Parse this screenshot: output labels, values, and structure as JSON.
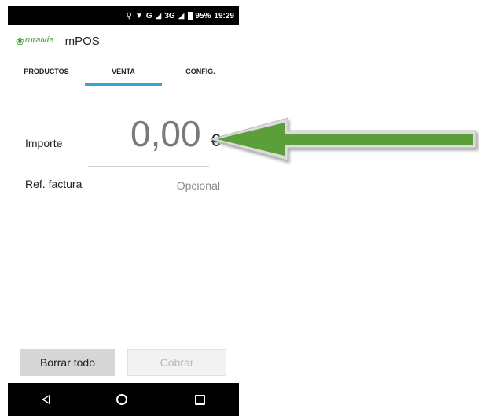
{
  "status_bar": {
    "network": "G",
    "network2": "3G",
    "battery": "95%",
    "time": "19:29"
  },
  "app_bar": {
    "logo_text": "ruralvía",
    "title": "mPOS"
  },
  "tabs": [
    {
      "label": "PRODUCTOS",
      "active": false
    },
    {
      "label": "VENTA",
      "active": true
    },
    {
      "label": "CONFIG.",
      "active": false
    }
  ],
  "form": {
    "amount_label": "Importe",
    "amount_value": "0,00",
    "currency": "€",
    "ref_label": "Ref. factura",
    "ref_placeholder": "Opcional"
  },
  "buttons": {
    "clear": "Borrar todo",
    "charge": "Cobrar"
  },
  "annotation": {
    "arrow_color": "#5b9e3a"
  }
}
